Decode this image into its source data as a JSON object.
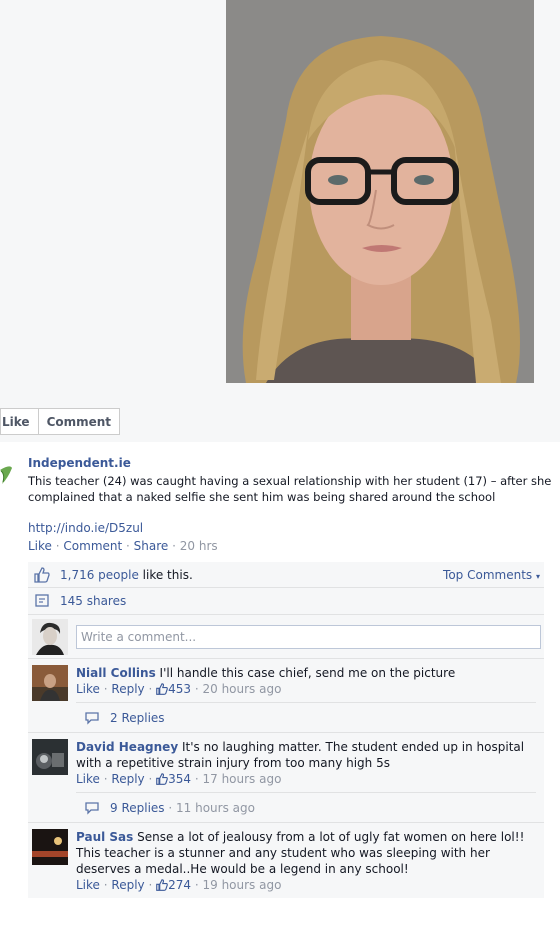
{
  "actions": {
    "like_label": "Like",
    "comment_label": "Comment"
  },
  "post": {
    "author": "Independent.ie",
    "text": "This teacher (24) was caught having a sexual relationship with her student (17) – after she complained that a naked selfie she sent him was being shared around the school",
    "link": "http://indo.ie/D5zul",
    "like": "Like",
    "comment": "Comment",
    "share": "Share",
    "time": "20 hrs"
  },
  "ufi": {
    "likes_count": "1,716 people",
    "likes_suffix": " like this.",
    "top_comments": "Top Comments",
    "shares": "145 shares",
    "write_placeholder": "Write a comment..."
  },
  "comments": [
    {
      "name": "Niall Collins",
      "text": " I'll handle this case chief, send me on the picture",
      "like": "Like",
      "reply": "Reply",
      "likes": "453",
      "time": "20 hours ago",
      "replies": "2 Replies",
      "replies_time": ""
    },
    {
      "name": "David Heagney",
      "text": " It's no laughing matter. The student ended up in hospital with a repetitive strain injury from too many high 5s",
      "like": "Like",
      "reply": "Reply",
      "likes": "354",
      "time": "17 hours ago",
      "replies": "9 Replies",
      "replies_time": "11 hours ago"
    },
    {
      "name": "Paul Sas",
      "text": " Sense a lot of jealousy from a lot of ugly fat women on here lol!! This teacher is a stunner and any student who was sleeping with her deserves a medal..He would be a legend in any school!",
      "like": "Like",
      "reply": "Reply",
      "likes": "274",
      "time": "19 hours ago"
    }
  ],
  "colors": {
    "link": "#3b5998",
    "meta": "#9197a3",
    "panel": "#f6f7f8"
  }
}
